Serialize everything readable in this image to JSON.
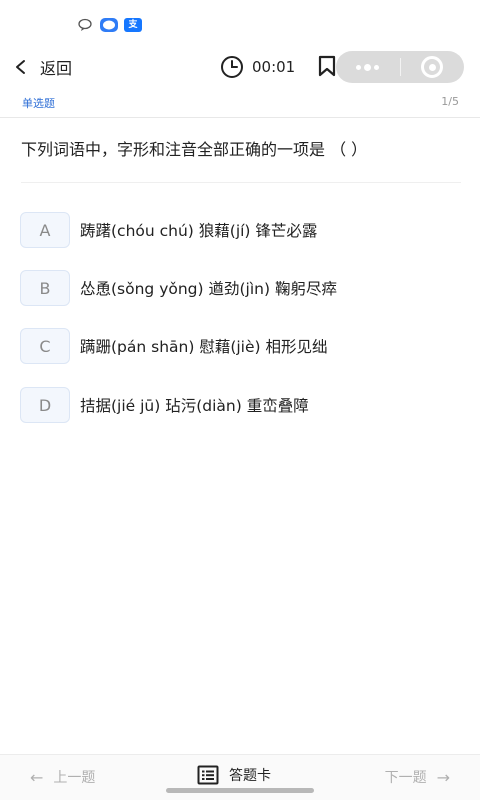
{
  "status_bar": {
    "icons": [
      "message-bubble-icon",
      "chat-app-icon",
      "alipay-icon"
    ],
    "alipay_glyph": "支",
    "msg_glyph": "♡"
  },
  "nav": {
    "back_label": "返回",
    "timer": "00:01"
  },
  "quiz": {
    "type_label": "单选题",
    "progress": "1/5",
    "question": "下列词语中，字形和注音全部正确的一项是 （ ）",
    "options": [
      {
        "letter": "A",
        "text": "踌躇(chóu chú) 狼藉(jí) 锋芒必露"
      },
      {
        "letter": "B",
        "text": "怂恿(sǒng yǒng) 遒劲(jìn) 鞠躬尽瘁"
      },
      {
        "letter": "C",
        "text": "蹒跚(pán shān) 慰藉(jiè) 相形见绌"
      },
      {
        "letter": "D",
        "text": "拮据(jié jū) 玷污(diàn) 重峦叠障"
      }
    ]
  },
  "footer": {
    "prev_label": "上一题",
    "card_label": "答题卡",
    "next_label": "下一题",
    "prev_arrow": "←",
    "next_arrow": "→"
  },
  "colors": {
    "accent": "#2f6fd6",
    "option_bg": "#f3f7fd",
    "option_border": "#dce6f5"
  }
}
